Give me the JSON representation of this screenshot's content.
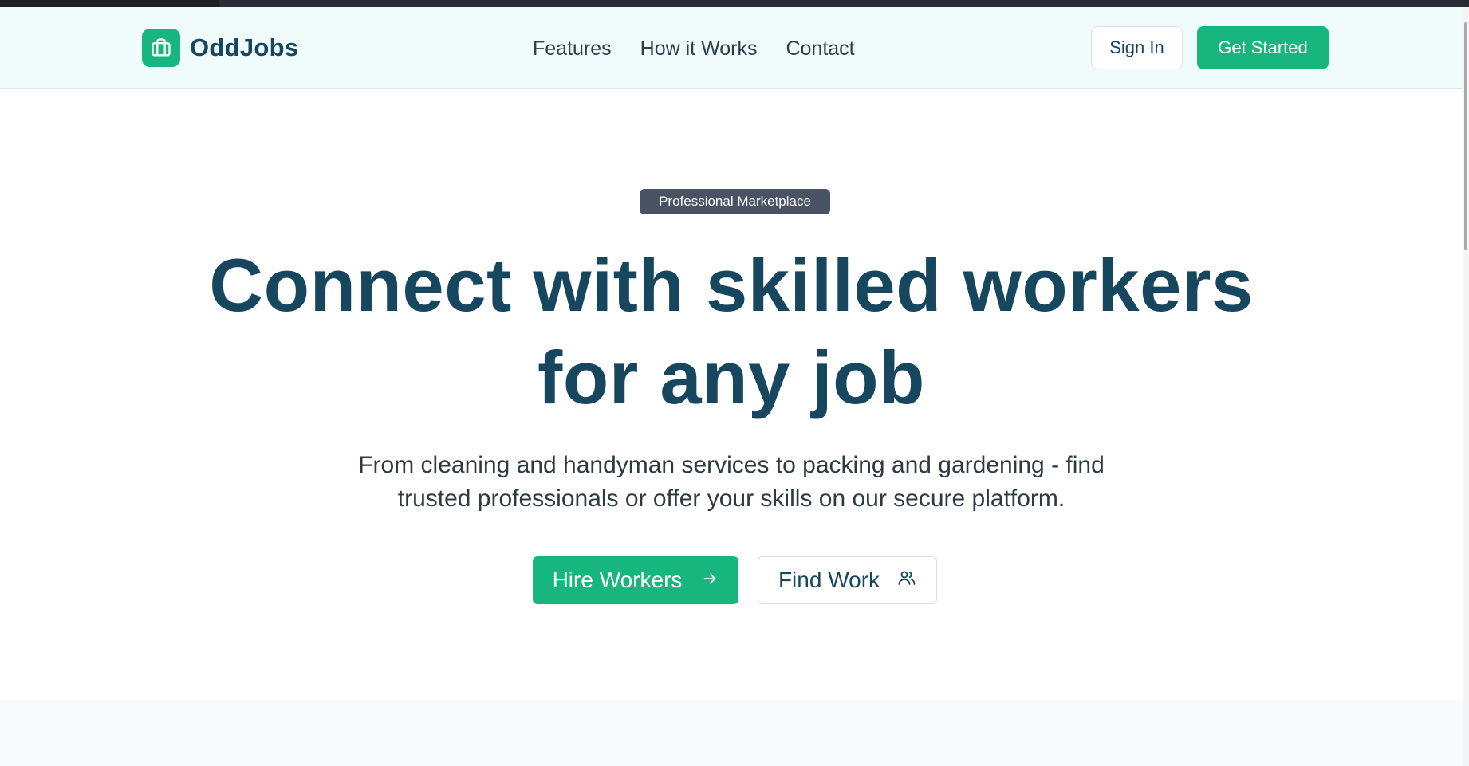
{
  "brand": {
    "name": "OddJobs",
    "icon": "briefcase-icon",
    "accent_color": "#16b67e"
  },
  "nav": {
    "items": [
      {
        "label": "Features"
      },
      {
        "label": "How it Works"
      },
      {
        "label": "Contact"
      }
    ]
  },
  "header_actions": {
    "sign_in": "Sign In",
    "get_started": "Get Started"
  },
  "hero": {
    "badge": "Professional Marketplace",
    "title_line1": "Connect with skilled workers",
    "title_line2": "for any job",
    "subtitle_line1": "From cleaning and handyman services to packing and gardening - find",
    "subtitle_line2": "trusted professionals or offer your skills on our secure platform.",
    "primary_cta": "Hire Workers",
    "primary_cta_icon": "arrow-right-icon",
    "secondary_cta": "Find Work",
    "secondary_cta_icon": "users-icon"
  },
  "colors": {
    "primary": "#16b67e",
    "heading": "#17475e",
    "badge_bg": "#4a5363",
    "header_bg": "#f0fbfc"
  }
}
